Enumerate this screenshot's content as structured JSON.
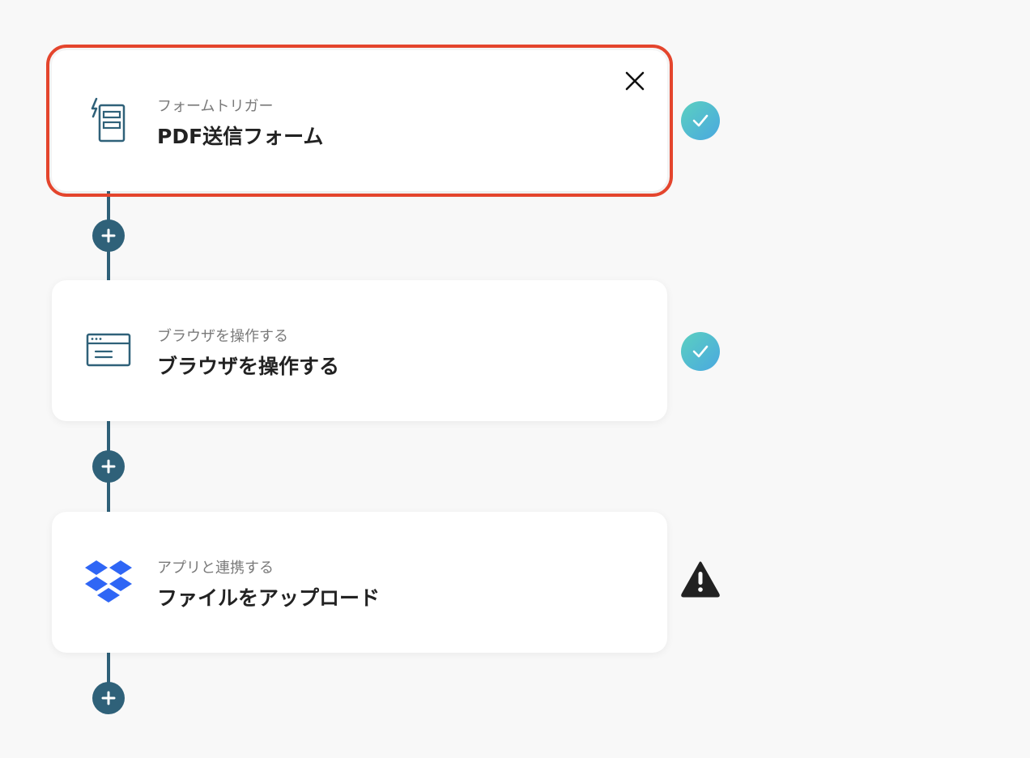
{
  "flow": {
    "steps": [
      {
        "subtitle": "フォームトリガー",
        "title": "PDF送信フォーム",
        "icon": "form-trigger-icon",
        "status": "complete",
        "selected": true
      },
      {
        "subtitle": "ブラウザを操作する",
        "title": "ブラウザを操作する",
        "icon": "browser-window-icon",
        "status": "complete",
        "selected": false
      },
      {
        "subtitle": "アプリと連携する",
        "title": "ファイルをアップロード",
        "icon": "dropbox-icon",
        "status": "warning",
        "selected": false
      }
    ],
    "add_step_buttons": 3
  },
  "colors": {
    "background": "#f8f8f8",
    "connector": "#2f6179",
    "selection_outline": "#e4452d",
    "check_gradient_start": "#5bd0c0",
    "check_gradient_end": "#4aa8e0",
    "warning": "#222222",
    "dropbox_blue": "#2f66f5",
    "icon_stroke": "#2f6179"
  }
}
